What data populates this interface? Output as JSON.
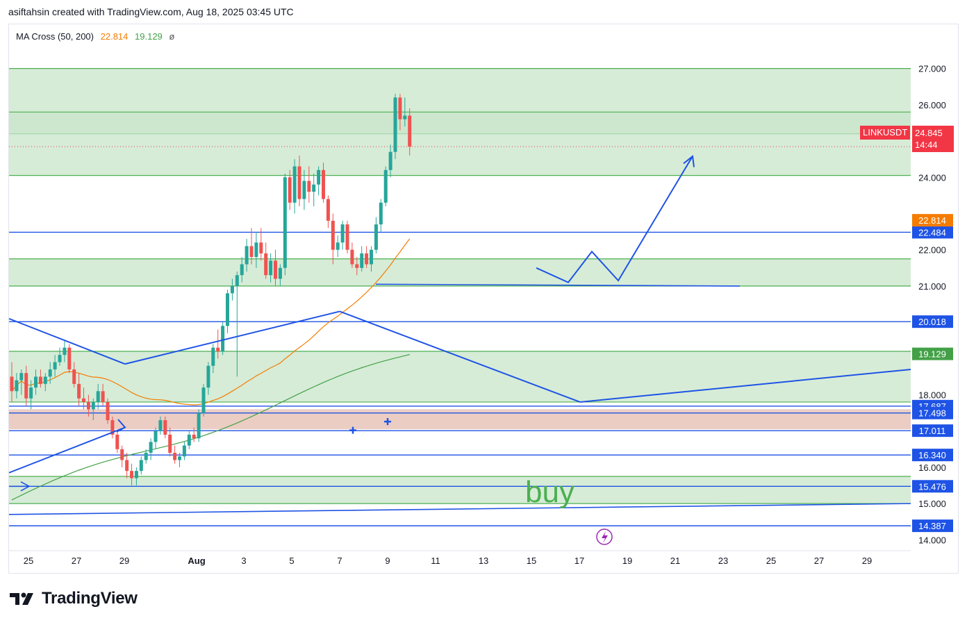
{
  "header": {
    "text": "asiftahsin created with TradingView.com, Aug 18, 2025 03:45 UTC"
  },
  "indicator": {
    "name": "MA Cross (50, 200)",
    "ma50_value": "22.814",
    "ma200_value": "19.129",
    "eye_icon": "ø"
  },
  "symbol_label": {
    "symbol": "LINKUSDT",
    "price": "24.845",
    "countdown": "14:44"
  },
  "annotation": {
    "buy": "buy"
  },
  "brand": {
    "name": "TradingView"
  },
  "colors": {
    "bull": "#26a69a",
    "bear": "#ef5350",
    "zone_green": "#c8e6c9",
    "zone_red": "#e8c4b8",
    "blue_line": "#1e53e5",
    "ma50": "#f57c00",
    "ma200": "#43a047",
    "price_badge": "#f23645"
  },
  "chart_data": {
    "type": "candlestick",
    "symbol": "LINKUSDT",
    "x_ticks": [
      "25",
      "27",
      "29",
      "Aug",
      "3",
      "5",
      "7",
      "9",
      "11",
      "13",
      "15",
      "17",
      "19",
      "21",
      "23",
      "25",
      "27",
      "29"
    ],
    "y_ticks": [
      "14.000",
      "15.000",
      "16.000",
      "18.000",
      "21.000",
      "22.000",
      "24.000",
      "26.000",
      "27.000"
    ],
    "ylim": [
      13.7,
      28.2
    ],
    "price_levels": [
      {
        "value": 22.484,
        "label": "22.484"
      },
      {
        "value": 20.018,
        "label": "20.018"
      },
      {
        "value": 17.687,
        "label": "17.687"
      },
      {
        "value": 17.498,
        "label": "17.498"
      },
      {
        "value": 17.011,
        "label": "17.011"
      },
      {
        "value": 16.34,
        "label": "16.340"
      },
      {
        "value": 15.476,
        "label": "15.476"
      },
      {
        "value": 14.387,
        "label": "14.387"
      }
    ],
    "ma_labels": [
      {
        "value": 22.814,
        "label": "22.814"
      },
      {
        "value": 19.129,
        "label": "19.129"
      }
    ],
    "zones_green": [
      [
        25.2,
        27.0
      ],
      [
        24.05,
        25.8
      ],
      [
        21.0,
        21.75
      ],
      [
        17.8,
        19.2
      ],
      [
        15.0,
        15.75
      ]
    ],
    "zones_red": [
      [
        17.05,
        17.6
      ]
    ],
    "current_price": 24.845,
    "candles": [
      {
        "o": 18.5,
        "h": 18.9,
        "l": 17.8,
        "c": 18.1
      },
      {
        "o": 18.1,
        "h": 18.6,
        "l": 17.9,
        "c": 18.4
      },
      {
        "o": 18.4,
        "h": 18.7,
        "l": 18.0,
        "c": 18.6
      },
      {
        "o": 18.6,
        "h": 18.8,
        "l": 17.7,
        "c": 17.9
      },
      {
        "o": 17.9,
        "h": 18.4,
        "l": 17.6,
        "c": 18.2
      },
      {
        "o": 18.2,
        "h": 18.7,
        "l": 18.0,
        "c": 18.5
      },
      {
        "o": 18.5,
        "h": 18.7,
        "l": 18.2,
        "c": 18.3
      },
      {
        "o": 18.3,
        "h": 18.6,
        "l": 18.1,
        "c": 18.5
      },
      {
        "o": 18.5,
        "h": 18.9,
        "l": 18.3,
        "c": 18.7
      },
      {
        "o": 18.7,
        "h": 19.1,
        "l": 18.5,
        "c": 18.9
      },
      {
        "o": 18.9,
        "h": 19.3,
        "l": 18.8,
        "c": 19.1
      },
      {
        "o": 19.1,
        "h": 19.5,
        "l": 18.9,
        "c": 19.3
      },
      {
        "o": 19.3,
        "h": 19.4,
        "l": 18.6,
        "c": 18.7
      },
      {
        "o": 18.7,
        "h": 18.9,
        "l": 18.2,
        "c": 18.3
      },
      {
        "o": 18.3,
        "h": 18.6,
        "l": 17.7,
        "c": 17.9
      },
      {
        "o": 17.9,
        "h": 18.2,
        "l": 17.6,
        "c": 17.8
      },
      {
        "o": 17.8,
        "h": 18.0,
        "l": 17.4,
        "c": 17.6
      },
      {
        "o": 17.6,
        "h": 17.9,
        "l": 17.3,
        "c": 17.8
      },
      {
        "o": 17.8,
        "h": 18.3,
        "l": 17.6,
        "c": 18.1
      },
      {
        "o": 18.1,
        "h": 18.3,
        "l": 17.7,
        "c": 17.8
      },
      {
        "o": 17.8,
        "h": 17.9,
        "l": 17.2,
        "c": 17.3
      },
      {
        "o": 17.3,
        "h": 17.4,
        "l": 16.8,
        "c": 16.9
      },
      {
        "o": 16.9,
        "h": 17.0,
        "l": 16.4,
        "c": 16.5
      },
      {
        "o": 16.5,
        "h": 16.6,
        "l": 16.0,
        "c": 16.2
      },
      {
        "o": 16.2,
        "h": 16.4,
        "l": 15.7,
        "c": 15.9
      },
      {
        "o": 15.9,
        "h": 16.1,
        "l": 15.5,
        "c": 15.7
      },
      {
        "o": 15.7,
        "h": 16.0,
        "l": 15.5,
        "c": 15.9
      },
      {
        "o": 15.9,
        "h": 16.3,
        "l": 15.8,
        "c": 16.2
      },
      {
        "o": 16.2,
        "h": 16.5,
        "l": 16.1,
        "c": 16.4
      },
      {
        "o": 16.4,
        "h": 16.8,
        "l": 16.2,
        "c": 16.7
      },
      {
        "o": 16.7,
        "h": 17.1,
        "l": 16.5,
        "c": 17.0
      },
      {
        "o": 17.0,
        "h": 17.4,
        "l": 16.9,
        "c": 17.3
      },
      {
        "o": 17.3,
        "h": 17.4,
        "l": 16.8,
        "c": 16.9
      },
      {
        "o": 16.9,
        "h": 17.1,
        "l": 16.3,
        "c": 16.4
      },
      {
        "o": 16.4,
        "h": 16.6,
        "l": 16.1,
        "c": 16.2
      },
      {
        "o": 16.2,
        "h": 16.4,
        "l": 16.0,
        "c": 16.3
      },
      {
        "o": 16.3,
        "h": 16.7,
        "l": 16.2,
        "c": 16.6
      },
      {
        "o": 16.6,
        "h": 17.0,
        "l": 16.5,
        "c": 16.9
      },
      {
        "o": 16.9,
        "h": 17.1,
        "l": 16.7,
        "c": 16.8
      },
      {
        "o": 16.8,
        "h": 17.6,
        "l": 16.7,
        "c": 17.5
      },
      {
        "o": 17.5,
        "h": 18.3,
        "l": 17.4,
        "c": 18.2
      },
      {
        "o": 18.2,
        "h": 18.9,
        "l": 18.0,
        "c": 18.8
      },
      {
        "o": 18.8,
        "h": 19.4,
        "l": 18.6,
        "c": 19.3
      },
      {
        "o": 19.3,
        "h": 19.8,
        "l": 19.0,
        "c": 19.2
      },
      {
        "o": 19.2,
        "h": 20.0,
        "l": 19.1,
        "c": 19.9
      },
      {
        "o": 19.9,
        "h": 20.9,
        "l": 19.7,
        "c": 20.8
      },
      {
        "o": 20.8,
        "h": 21.2,
        "l": 20.6,
        "c": 21.0
      },
      {
        "o": 21.0,
        "h": 21.4,
        "l": 18.5,
        "c": 21.3
      },
      {
        "o": 21.3,
        "h": 21.8,
        "l": 21.1,
        "c": 21.6
      },
      {
        "o": 21.6,
        "h": 22.3,
        "l": 21.4,
        "c": 22.1
      },
      {
        "o": 22.1,
        "h": 22.6,
        "l": 21.6,
        "c": 21.8
      },
      {
        "o": 21.8,
        "h": 22.5,
        "l": 21.5,
        "c": 22.2
      },
      {
        "o": 22.2,
        "h": 22.6,
        "l": 21.7,
        "c": 21.9
      },
      {
        "o": 21.9,
        "h": 22.2,
        "l": 21.2,
        "c": 21.3
      },
      {
        "o": 21.3,
        "h": 21.9,
        "l": 21.1,
        "c": 21.7
      },
      {
        "o": 21.7,
        "h": 22.0,
        "l": 21.0,
        "c": 21.2
      },
      {
        "o": 21.2,
        "h": 21.6,
        "l": 21.0,
        "c": 21.5
      },
      {
        "o": 21.5,
        "h": 24.1,
        "l": 21.3,
        "c": 24.0
      },
      {
        "o": 24.0,
        "h": 24.2,
        "l": 23.1,
        "c": 23.3
      },
      {
        "o": 23.3,
        "h": 24.5,
        "l": 23.0,
        "c": 24.3
      },
      {
        "o": 24.3,
        "h": 24.6,
        "l": 23.2,
        "c": 23.4
      },
      {
        "o": 23.4,
        "h": 24.2,
        "l": 23.1,
        "c": 23.9
      },
      {
        "o": 23.9,
        "h": 24.3,
        "l": 23.3,
        "c": 23.6
      },
      {
        "o": 23.6,
        "h": 24.1,
        "l": 23.2,
        "c": 23.8
      },
      {
        "o": 23.8,
        "h": 24.3,
        "l": 23.5,
        "c": 24.2
      },
      {
        "o": 24.2,
        "h": 24.4,
        "l": 23.3,
        "c": 23.4
      },
      {
        "o": 23.4,
        "h": 23.5,
        "l": 22.6,
        "c": 22.8
      },
      {
        "o": 22.8,
        "h": 23.0,
        "l": 21.6,
        "c": 22.0
      },
      {
        "o": 22.0,
        "h": 22.4,
        "l": 21.8,
        "c": 22.2
      },
      {
        "o": 22.2,
        "h": 22.8,
        "l": 22.0,
        "c": 22.7
      },
      {
        "o": 22.7,
        "h": 22.8,
        "l": 21.9,
        "c": 22.0
      },
      {
        "o": 22.0,
        "h": 22.2,
        "l": 21.5,
        "c": 21.6
      },
      {
        "o": 21.6,
        "h": 21.8,
        "l": 21.3,
        "c": 21.5
      },
      {
        "o": 21.5,
        "h": 22.1,
        "l": 21.4,
        "c": 21.9
      },
      {
        "o": 21.9,
        "h": 22.1,
        "l": 21.5,
        "c": 21.6
      },
      {
        "o": 21.6,
        "h": 22.1,
        "l": 21.4,
        "c": 22.0
      },
      {
        "o": 22.0,
        "h": 22.9,
        "l": 21.9,
        "c": 22.7
      },
      {
        "o": 22.7,
        "h": 23.4,
        "l": 22.5,
        "c": 23.3
      },
      {
        "o": 23.3,
        "h": 24.3,
        "l": 23.2,
        "c": 24.2
      },
      {
        "o": 24.2,
        "h": 24.9,
        "l": 24.0,
        "c": 24.7
      },
      {
        "o": 24.7,
        "h": 26.3,
        "l": 24.5,
        "c": 26.2
      },
      {
        "o": 26.2,
        "h": 26.3,
        "l": 25.3,
        "c": 25.6
      },
      {
        "o": 25.6,
        "h": 26.2,
        "l": 25.4,
        "c": 25.7
      },
      {
        "o": 25.7,
        "h": 25.9,
        "l": 24.6,
        "c": 24.845
      }
    ]
  }
}
